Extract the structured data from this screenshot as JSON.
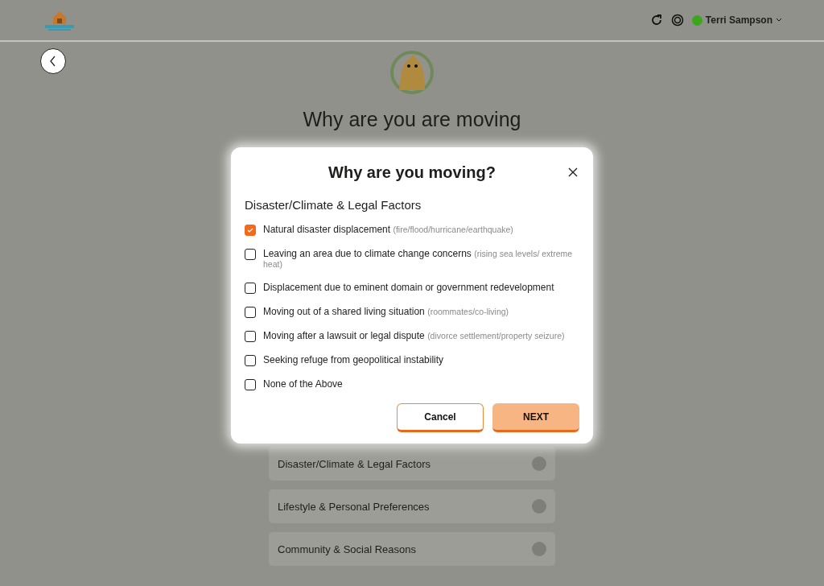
{
  "header": {
    "user_name": "Terri Sampson"
  },
  "page": {
    "title": "Why are you are moving",
    "categories": [
      {
        "label": "Disaster/Climate & Legal Factors",
        "selected": false
      },
      {
        "label": "Lifestyle & Personal Preferences",
        "selected": false
      },
      {
        "label": "Community & Social Reasons",
        "selected": false
      }
    ]
  },
  "dialog": {
    "title": "Why are you moving?",
    "section": "Disaster/Climate & Legal Factors",
    "options": [
      {
        "label": "Natural disaster displacement",
        "hint": "(fire/flood/hurricane/earthquake)",
        "checked": true
      },
      {
        "label": "Leaving an area due to climate change concerns",
        "hint": "(rising sea levels/ extreme heat)",
        "checked": false
      },
      {
        "label": "Displacement due to eminent domain or government redevelopment",
        "checked": false
      },
      {
        "label": "Moving out of a shared living situation",
        "hint": "(roommates/co-living)",
        "checked": false
      },
      {
        "label": "Moving after a lawsuit or legal dispute",
        "hint": "(divorce settlement/property seizure)",
        "checked": false
      },
      {
        "label": "Seeking refuge from geopolitical instability",
        "checked": false
      },
      {
        "label": "None of the Above",
        "checked": false
      }
    ],
    "buttons": [
      {
        "kind": "secondary",
        "label": "Cancel"
      },
      {
        "kind": "primary",
        "label": "NEXT"
      }
    ]
  }
}
